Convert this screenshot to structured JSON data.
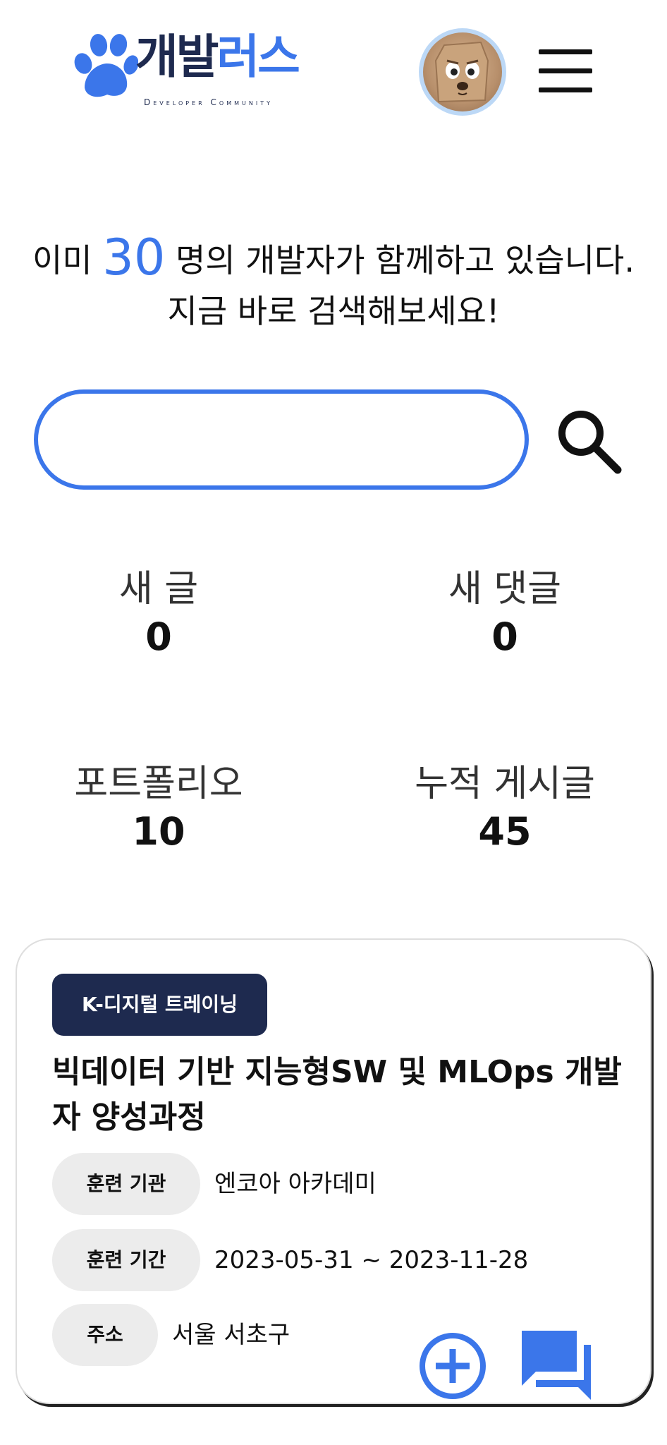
{
  "header": {
    "logo_title_main": "개발",
    "logo_title_accent": "러스",
    "logo_subtitle": "Developer Community",
    "menu_icon": "hamburger-menu-icon",
    "avatar_icon": "character-avatar"
  },
  "headline": {
    "prefix": "이미",
    "count": "30",
    "suffix": "명의 개발자가 함께하고 있습니다.",
    "line2": "지금 바로 검색해보세요!"
  },
  "search": {
    "value": "",
    "placeholder": "",
    "button_icon": "search-icon"
  },
  "stats": [
    {
      "label": "새 글",
      "value": "0"
    },
    {
      "label": "새 댓글",
      "value": "0"
    },
    {
      "label": "포트폴리오",
      "value": "10"
    },
    {
      "label": "누적 게시글",
      "value": "45"
    }
  ],
  "card": {
    "badge": "K-디지털 트레이닝",
    "title": "빅데이터 기반 지능형SW 및 MLOps 개발자 양성과정",
    "rows": [
      {
        "label": "훈련 기관",
        "value": "엔코아 아카데미"
      },
      {
        "label": "훈련 기간",
        "value": "2023-05-31 ~ 2023-11-28"
      },
      {
        "label": "주소",
        "value": "서울 서초구"
      }
    ]
  },
  "fabs": {
    "add_icon": "plus-circle-icon",
    "chat_icon": "chat-bubbles-icon"
  },
  "colors": {
    "accent": "#3b76ea",
    "navy": "#1e2a4f",
    "chip": "#ececec"
  }
}
